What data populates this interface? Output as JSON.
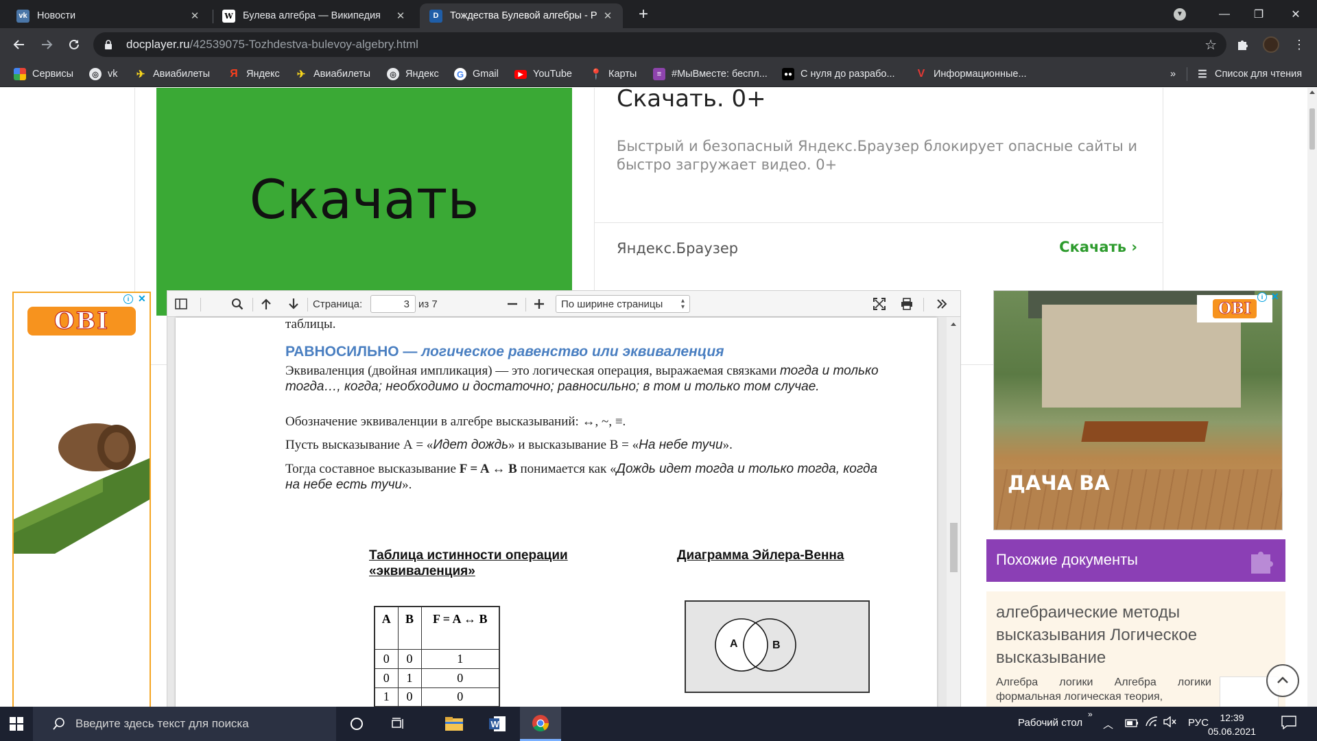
{
  "browser": {
    "tabs": [
      {
        "title": "Новости",
        "icon": "vk-icon",
        "active": false
      },
      {
        "title": "Булева алгебра — Википедия",
        "icon": "wikipedia-icon",
        "active": false
      },
      {
        "title": "Тождества Булевой алгебры - Р",
        "icon": "docplayer-icon",
        "active": true
      }
    ],
    "url_domain": "docplayer.ru",
    "url_path": "/42539075-Tozhdestva-bulevoy-algebry.html",
    "bookmarks": [
      "Сервисы",
      "vk",
      "Авиабилеты",
      "Яндекс",
      "Авиабилеты",
      "Яндекс",
      "Gmail",
      "YouTube",
      "Карты",
      "#МыВместе: беспл...",
      "С нуля до разрабо...",
      "Информационные..."
    ],
    "bookmarks_overflow": "»",
    "reading_list": "Список для чтения"
  },
  "ad_top": {
    "button_text": "Скачать",
    "headline": "Скачать. 0+",
    "description": "Быстрый и безопасный Яндекс.Браузер блокирует опасные сайты и быстро загружает видео. 0+",
    "brand": "Яндекс.Браузер",
    "cta": "Скачать"
  },
  "ad_left": {
    "logo": "OBI"
  },
  "ad_right": {
    "logo": "OBI",
    "banner": "ДАЧА ВА"
  },
  "viewer": {
    "page_label": "Страница:",
    "page_current": "3",
    "page_total": "из 7",
    "zoom": "По ширине страницы"
  },
  "document": {
    "prev_line": "таблицы.",
    "heading": "РАВНОСИЛЬНО — логическое равенство или эквиваленция",
    "heading_main": "РАВНОСИЛЬНО —",
    "heading_rest": "логическое равенство или эквиваленция",
    "p1_start": "Эквиваленция (двойная импликация) — это логическая операция, выражаемая связками ",
    "p1_italic": "тогда и только тогда…, когда; необходимо и достаточно; равносильно; в том и только том случае.",
    "p2": "Обозначение эквиваленции в алгебре высказываний: ↔,  ~, ≡.",
    "p3_a": "Пусть высказывание А = «",
    "p3_b": "Идет дождь",
    "p3_c": "» и высказывание В = «",
    "p3_d": "На небе тучи",
    "p3_e": "».",
    "p4_a": "Тогда составное высказывание ",
    "p4_b": "F = A ↔ B",
    "p4_c": " понимается как «",
    "p4_d": "Дождь идет тогда и только тогда, когда на небе есть тучи",
    "p4_e": "».",
    "table_title": "Таблица истинности операции «эквиваленция»",
    "venn_title": "Диаграмма Эйлера-Венна",
    "table": {
      "headers": [
        "A",
        "B",
        "F = A ↔ B"
      ],
      "rows": [
        [
          "0",
          "0",
          "1"
        ],
        [
          "0",
          "1",
          "0"
        ],
        [
          "1",
          "0",
          "0"
        ]
      ]
    },
    "venn_labels": [
      "A",
      "B"
    ]
  },
  "similar": {
    "title": "Похожие документы",
    "doc_title": "алгебраические методы высказывания Логическое высказывание",
    "doc_snippet": "Алгебра логики Алгебра логики формальная логическая теория,"
  },
  "taskbar": {
    "search_placeholder": "Введите здесь текст для поиска",
    "desktop": "Рабочий стол",
    "lang": "РУС",
    "time": "12:39",
    "date": "05.06.2021"
  },
  "colors": {
    "ad_green": "#3aa935",
    "heading_blue": "#4a7fc1",
    "similar_purple": "#8b3fb5",
    "obi_orange": "#f7931e",
    "cta_green": "#2d9b2d"
  }
}
